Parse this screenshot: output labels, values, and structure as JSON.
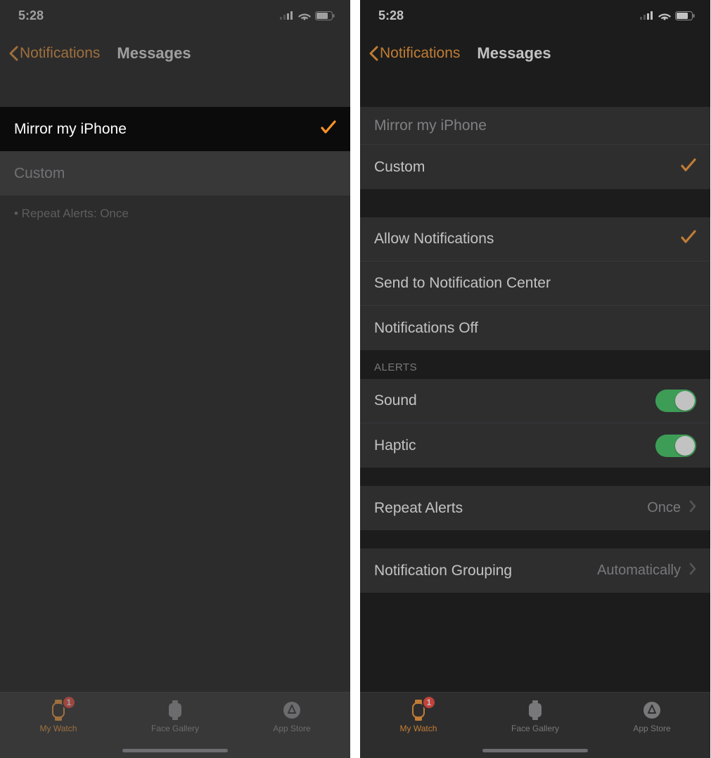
{
  "status": {
    "time": "5:28"
  },
  "nav": {
    "back": "Notifications",
    "title": "Messages"
  },
  "left": {
    "rows": {
      "mirror": "Mirror my iPhone",
      "custom": "Custom"
    },
    "hint_prefix": "• Repeat Alerts: ",
    "hint_value": "Once"
  },
  "right": {
    "top": {
      "mirror": "Mirror my iPhone",
      "custom": "Custom"
    },
    "notif": {
      "allow": "Allow Notifications",
      "send_center": "Send to Notification Center",
      "off": "Notifications Off"
    },
    "alerts_header": "ALERTS",
    "alerts": {
      "sound": {
        "label": "Sound",
        "on": true
      },
      "haptic": {
        "label": "Haptic",
        "on": true
      }
    },
    "repeat": {
      "label": "Repeat Alerts",
      "value": "Once"
    },
    "grouping": {
      "label": "Notification Grouping",
      "value": "Automatically"
    }
  },
  "tabs": {
    "watch": "My Watch",
    "gallery": "Face Gallery",
    "store": "App Store",
    "badge": "1"
  }
}
